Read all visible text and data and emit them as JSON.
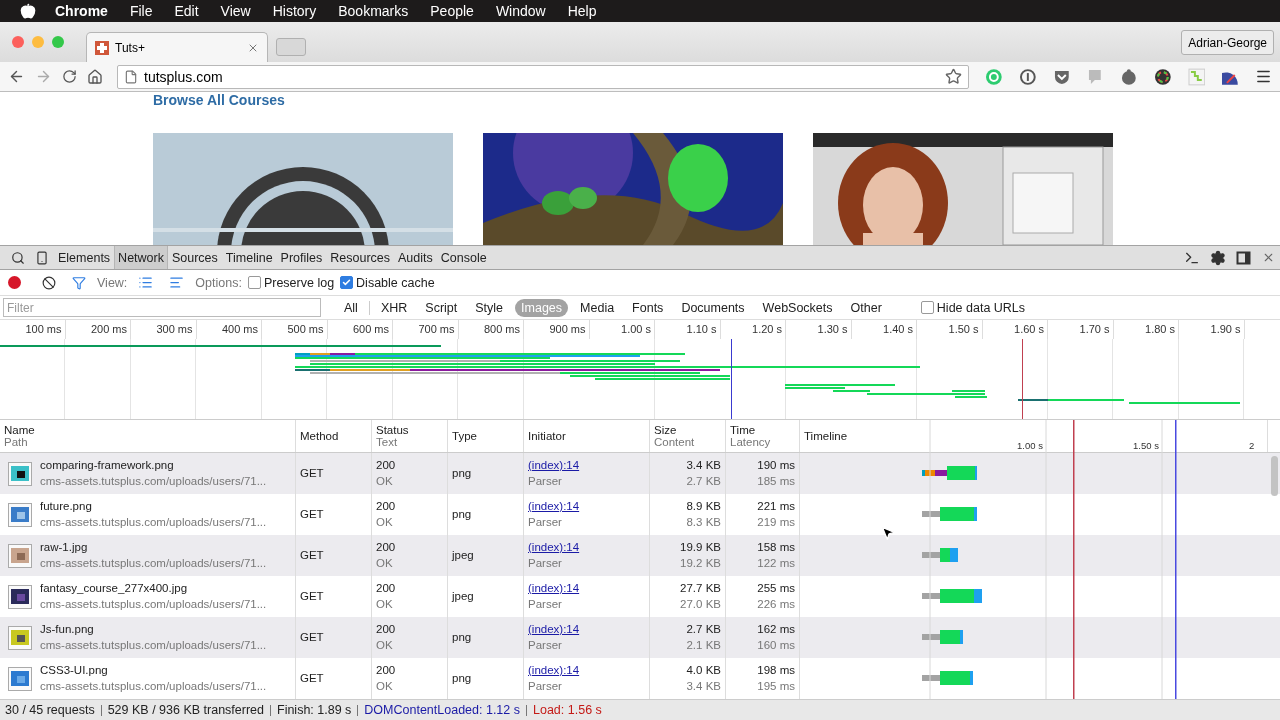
{
  "menu_bar": {
    "app": "Chrome",
    "items": [
      "File",
      "Edit",
      "View",
      "History",
      "Bookmarks",
      "People",
      "Window",
      "Help"
    ]
  },
  "tabs": [
    {
      "title": "Tuts+",
      "selected": true
    }
  ],
  "profile": "Adrian-George",
  "address": "tutsplus.com",
  "page": {
    "link": "Browse All Courses"
  },
  "devtools": {
    "panels": [
      {
        "label": "Elements",
        "selected": false
      },
      {
        "label": "Network",
        "selected": true
      },
      {
        "label": "Sources",
        "selected": false
      },
      {
        "label": "Timeline",
        "selected": false
      },
      {
        "label": "Profiles",
        "selected": false
      },
      {
        "label": "Resources",
        "selected": false
      },
      {
        "label": "Audits",
        "selected": false
      },
      {
        "label": "Console",
        "selected": false
      }
    ],
    "recording": true,
    "view_label": "View:",
    "options_label": "Options:",
    "options": [
      {
        "label": "Preserve log",
        "checked": false
      },
      {
        "label": "Disable cache",
        "checked": true
      }
    ],
    "filter": {
      "placeholder": "Filter"
    },
    "types": [
      {
        "label": "All",
        "selected": false
      },
      {
        "label": "XHR",
        "selected": false
      },
      {
        "label": "Script",
        "selected": false
      },
      {
        "label": "Style",
        "selected": false
      },
      {
        "label": "Images",
        "selected": true
      },
      {
        "label": "Media",
        "selected": false
      },
      {
        "label": "Fonts",
        "selected": false
      },
      {
        "label": "Documents",
        "selected": false
      },
      {
        "label": "WebSockets",
        "selected": false
      },
      {
        "label": "Other",
        "selected": false
      }
    ],
    "hide_data_urls": {
      "label": "Hide data URLs",
      "checked": false
    },
    "overview_ticks": [
      "100 ms",
      "200 ms",
      "300 ms",
      "400 ms",
      "500 ms",
      "600 ms",
      "700 ms",
      "800 ms",
      "900 ms",
      "1.00 s",
      "1.10 s",
      "1.20 s",
      "1.30 s",
      "1.40 s",
      "1.50 s",
      "1.60 s",
      "1.70 s",
      "1.80 s",
      "1.90 s"
    ],
    "columns": [
      {
        "title": "Name",
        "subtitle": "Path"
      },
      {
        "title": "Method"
      },
      {
        "title": "Status",
        "subtitle": "Text"
      },
      {
        "title": "Type"
      },
      {
        "title": "Initiator"
      },
      {
        "title": "Size",
        "subtitle": "Content"
      },
      {
        "title": "Time",
        "subtitle": "Latency"
      },
      {
        "title": "Timeline"
      }
    ],
    "timeline_ticks": [
      "1.00 s",
      "1.50 s",
      "2"
    ],
    "rows": [
      {
        "name": "comparing-framework.png",
        "path": "cms-assets.tutsplus.com/uploads/users/71...",
        "method": "GET",
        "status": "200",
        "status_text": "OK",
        "type": "png",
        "initiator": "(index):14",
        "initiator_kind": "Parser",
        "size": "3.4 KB",
        "content": "2.7 KB",
        "time": "190 ms",
        "latency": "185 ms"
      },
      {
        "name": "future.png",
        "path": "cms-assets.tutsplus.com/uploads/users/71...",
        "method": "GET",
        "status": "200",
        "status_text": "OK",
        "type": "png",
        "initiator": "(index):14",
        "initiator_kind": "Parser",
        "size": "8.9 KB",
        "content": "8.3 KB",
        "time": "221 ms",
        "latency": "219 ms"
      },
      {
        "name": "raw-1.jpg",
        "path": "cms-assets.tutsplus.com/uploads/users/71...",
        "method": "GET",
        "status": "200",
        "status_text": "OK",
        "type": "jpeg",
        "initiator": "(index):14",
        "initiator_kind": "Parser",
        "size": "19.9 KB",
        "content": "19.2 KB",
        "time": "158 ms",
        "latency": "122 ms"
      },
      {
        "name": "fantasy_course_277x400.jpg",
        "path": "cms-assets.tutsplus.com/uploads/users/71...",
        "method": "GET",
        "status": "200",
        "status_text": "OK",
        "type": "jpeg",
        "initiator": "(index):14",
        "initiator_kind": "Parser",
        "size": "27.7 KB",
        "content": "27.0 KB",
        "time": "255 ms",
        "latency": "226 ms"
      },
      {
        "name": "Js-fun.png",
        "path": "cms-assets.tutsplus.com/uploads/users/71...",
        "method": "GET",
        "status": "200",
        "status_text": "OK",
        "type": "png",
        "initiator": "(index):14",
        "initiator_kind": "Parser",
        "size": "2.7 KB",
        "content": "2.1 KB",
        "time": "162 ms",
        "latency": "160 ms"
      },
      {
        "name": "CSS3-UI.png",
        "path": "cms-assets.tutsplus.com/uploads/users/71...",
        "method": "GET",
        "status": "200",
        "status_text": "OK",
        "type": "png",
        "initiator": "(index):14",
        "initiator_kind": "Parser",
        "size": "4.0 KB",
        "content": "3.4 KB",
        "time": "198 ms",
        "latency": "195 ms"
      }
    ],
    "status_bar": [
      {
        "text": "30 / 45 requests",
        "kind": "plain"
      },
      {
        "text": "529 KB / 936 KB transferred",
        "kind": "plain"
      },
      {
        "text": "Finish: 1.89 s",
        "kind": "plain"
      },
      {
        "text": "DOMContentLoaded: 1.12 s",
        "kind": "dom"
      },
      {
        "text": "Load: 1.56 s",
        "kind": "load"
      }
    ]
  }
}
